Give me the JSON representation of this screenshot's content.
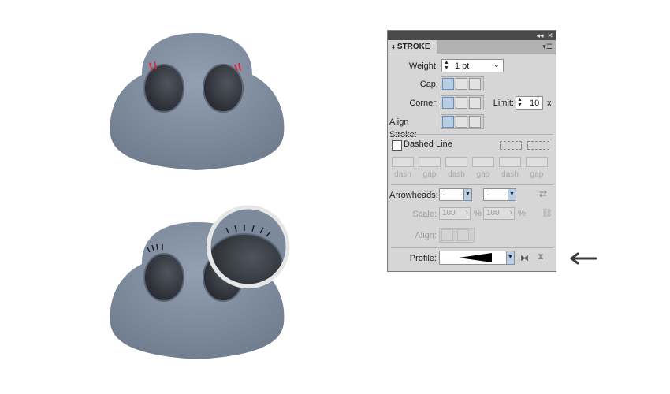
{
  "panel": {
    "title": "STROKE",
    "weight_label": "Weight:",
    "weight_value": "1 pt",
    "cap_label": "Cap:",
    "corner_label": "Corner:",
    "limit_label": "Limit:",
    "limit_value": "10",
    "limit_suffix": "x",
    "align_stroke_label": "Align Stroke:",
    "dashed_line_label": "Dashed Line",
    "dash_labels": [
      "dash",
      "gap",
      "dash",
      "gap",
      "dash",
      "gap"
    ],
    "arrowheads_label": "Arrowheads:",
    "scale_label": "Scale:",
    "scale_value_1": "100",
    "scale_value_2": "100",
    "percent": "%",
    "align_label": "Align:",
    "profile_label": "Profile:"
  },
  "colors": {
    "character_fill": "#7d8a9c",
    "eye_fill": "#24272c",
    "eyelash_red": "#d42b3c",
    "panel_bg": "#d6d6d6",
    "selected_button": "#b8cde6"
  }
}
